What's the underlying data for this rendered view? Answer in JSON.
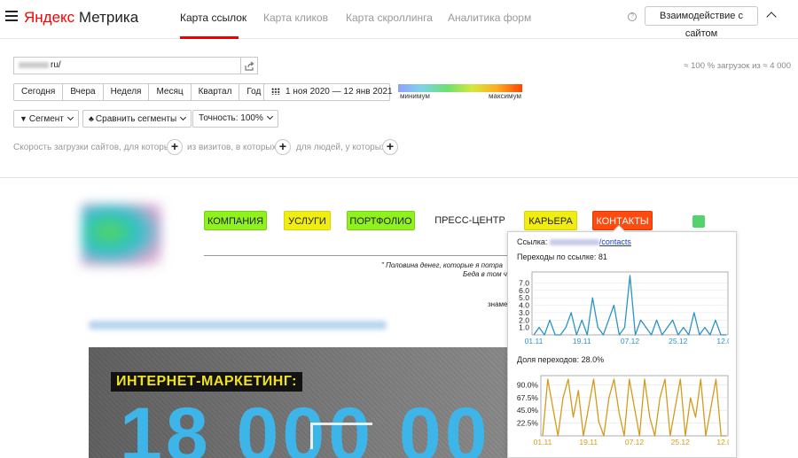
{
  "header": {
    "logo_ya": "Яндекс",
    "logo_product": "Метрика",
    "tabs": [
      {
        "label": "Карта ссылок",
        "active": true
      },
      {
        "label": "Карта кликов",
        "active": false
      },
      {
        "label": "Карта скроллинга",
        "active": false
      },
      {
        "label": "Аналитика форм",
        "active": false
      }
    ],
    "help_glyph": "?",
    "interact_button": "Взаимодействие с сайтом"
  },
  "controls": {
    "url_suffix": "ru/",
    "load_info": "≈ 100 % загрузок из ≈ 4 000",
    "periods": [
      "Сегодня",
      "Вчера",
      "Неделя",
      "Месяц",
      "Квартал",
      "Год"
    ],
    "date_range": "1 ноя 2020 — 12 янв 2021",
    "scale_min": "минимум",
    "scale_max": "максимум",
    "segment": "Сегмент",
    "compare": "Сравнить сегменты",
    "accuracy": "Точность: 100%",
    "filter_1": "Скорость загрузки сайтов, для которых",
    "filter_2": "из визитов, в которых",
    "filter_3": "для людей, у которых",
    "plus": "+"
  },
  "site": {
    "nav": [
      {
        "label": "КОМПАНИЯ",
        "style": "green"
      },
      {
        "label": "УСЛУГИ",
        "style": "yellow"
      },
      {
        "label": "ПОРТФОЛИО",
        "style": "green"
      },
      {
        "label": "ПРЕСС-ЦЕНТР",
        "style": "plain"
      },
      {
        "label": "КАРЬЕРА",
        "style": "yellow"
      },
      {
        "label": "КОНТАКТЫ",
        "style": "red"
      }
    ],
    "quote_line1": "\" Половина денег, которые я потра",
    "quote_line2": "Беда в том ч",
    "quote_line3": "знаме",
    "banner_label": "ИНТЕРНЕТ-МАРКЕТИНГ:",
    "banner_number": "18 000 00"
  },
  "popup": {
    "link_label": "Ссылка:",
    "link_path": "/contacts",
    "clicks_label": "Переходы по ссылке: 81",
    "share_label": "Доля переходов: 28.0%",
    "colors": {
      "clicks_line": "#2b93c8",
      "share_line": "#d49a1d"
    }
  },
  "chart_data": [
    {
      "type": "line",
      "x": [
        "01.11",
        "03.11",
        "05.11",
        "07.11",
        "09.11",
        "11.11",
        "13.11",
        "15.11",
        "17.11",
        "19.11",
        "21.11",
        "23.11",
        "25.11",
        "27.11",
        "29.11",
        "01.12",
        "03.12",
        "05.12",
        "07.12",
        "09.12",
        "11.12",
        "13.12",
        "15.12",
        "17.12",
        "19.12",
        "21.12",
        "23.12",
        "25.12",
        "27.12",
        "29.12",
        "31.12",
        "02.01",
        "04.01",
        "06.01",
        "08.01",
        "10.01",
        "12.01"
      ],
      "values": [
        0,
        1,
        0,
        2,
        0,
        0,
        1,
        3,
        0,
        2,
        0,
        5,
        1,
        0,
        2,
        4,
        0,
        1,
        8,
        0,
        2,
        1,
        0,
        2,
        0,
        1,
        2,
        0,
        1,
        0,
        3,
        0,
        1,
        0,
        2,
        0,
        0
      ],
      "xticks": [
        "01.11",
        "19.11",
        "07.12",
        "25.12",
        "12.01"
      ],
      "yticks": [
        "1.0",
        "2.0",
        "3.0",
        "4.0",
        "5.0",
        "6.0",
        "7.0"
      ],
      "ylim": [
        0,
        8
      ]
    },
    {
      "type": "line",
      "x": [
        "01.11",
        "03.11",
        "05.11",
        "07.11",
        "09.11",
        "11.11",
        "13.11",
        "15.11",
        "17.11",
        "19.11",
        "21.11",
        "23.11",
        "25.11",
        "27.11",
        "29.11",
        "01.12",
        "03.12",
        "05.12",
        "07.12",
        "09.12",
        "11.12",
        "13.12",
        "15.12",
        "17.12",
        "19.12",
        "21.12",
        "23.12",
        "25.12",
        "27.12",
        "29.12",
        "31.12",
        "02.01",
        "04.01",
        "06.01",
        "08.01",
        "10.01",
        "12.01"
      ],
      "values": [
        0,
        100,
        50,
        0,
        67,
        100,
        33,
        80,
        0,
        50,
        100,
        25,
        0,
        67,
        100,
        40,
        0,
        100,
        50,
        0,
        100,
        33,
        0,
        67,
        100,
        0,
        50,
        100,
        0,
        67,
        33,
        100,
        0,
        50,
        100,
        0,
        0
      ],
      "xticks": [
        "01.11",
        "19.11",
        "07.12",
        "25.12",
        "12.01"
      ],
      "yticks": [
        "22.5%",
        "45.0%",
        "67.5%",
        "90.0%"
      ],
      "ylim": [
        0,
        100
      ]
    }
  ]
}
